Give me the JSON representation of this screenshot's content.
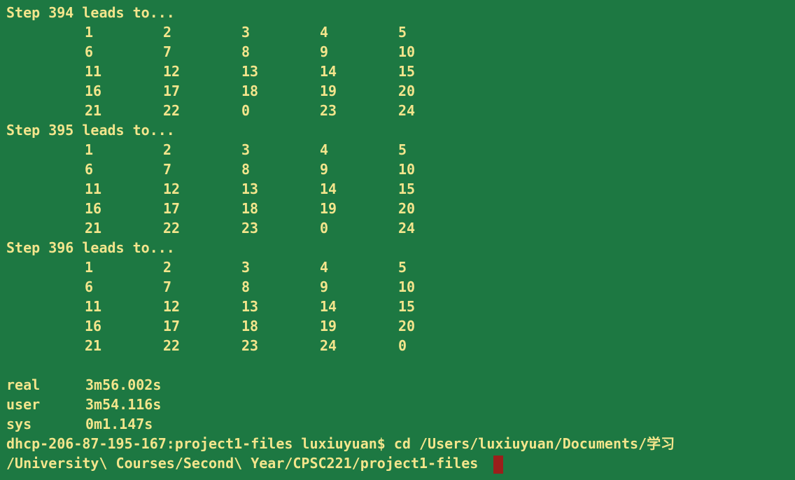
{
  "colors": {
    "background": "#1d7842",
    "text": "#f3e58c",
    "cursor": "#9b1f1b"
  },
  "steps": [
    {
      "header": "Step 394 leads to...",
      "rows": [
        [
          "1",
          "2",
          "3",
          "4",
          "5"
        ],
        [
          "6",
          "7",
          "8",
          "9",
          "10"
        ],
        [
          "11",
          "12",
          "13",
          "14",
          "15"
        ],
        [
          "16",
          "17",
          "18",
          "19",
          "20"
        ],
        [
          "21",
          "22",
          "0",
          "23",
          "24"
        ]
      ]
    },
    {
      "header": "Step 395 leads to...",
      "rows": [
        [
          "1",
          "2",
          "3",
          "4",
          "5"
        ],
        [
          "6",
          "7",
          "8",
          "9",
          "10"
        ],
        [
          "11",
          "12",
          "13",
          "14",
          "15"
        ],
        [
          "16",
          "17",
          "18",
          "19",
          "20"
        ],
        [
          "21",
          "22",
          "23",
          "0",
          "24"
        ]
      ]
    },
    {
      "header": "Step 396 leads to...",
      "rows": [
        [
          "1",
          "2",
          "3",
          "4",
          "5"
        ],
        [
          "6",
          "7",
          "8",
          "9",
          "10"
        ],
        [
          "11",
          "12",
          "13",
          "14",
          "15"
        ],
        [
          "16",
          "17",
          "18",
          "19",
          "20"
        ],
        [
          "21",
          "22",
          "23",
          "24",
          "0"
        ]
      ]
    }
  ],
  "timing": {
    "real_label": "real",
    "real_value": "3m56.002s",
    "user_label": "user",
    "user_value": "3m54.116s",
    "sys_label": "sys",
    "sys_value": "0m1.147s"
  },
  "prompt": {
    "line1": "dhcp-206-87-195-167:project1-files luxiuyuan$ cd /Users/luxiuyuan/Documents/学习",
    "line2": "/University\\ Courses/Second\\ Year/CPSC221/project1-files "
  }
}
